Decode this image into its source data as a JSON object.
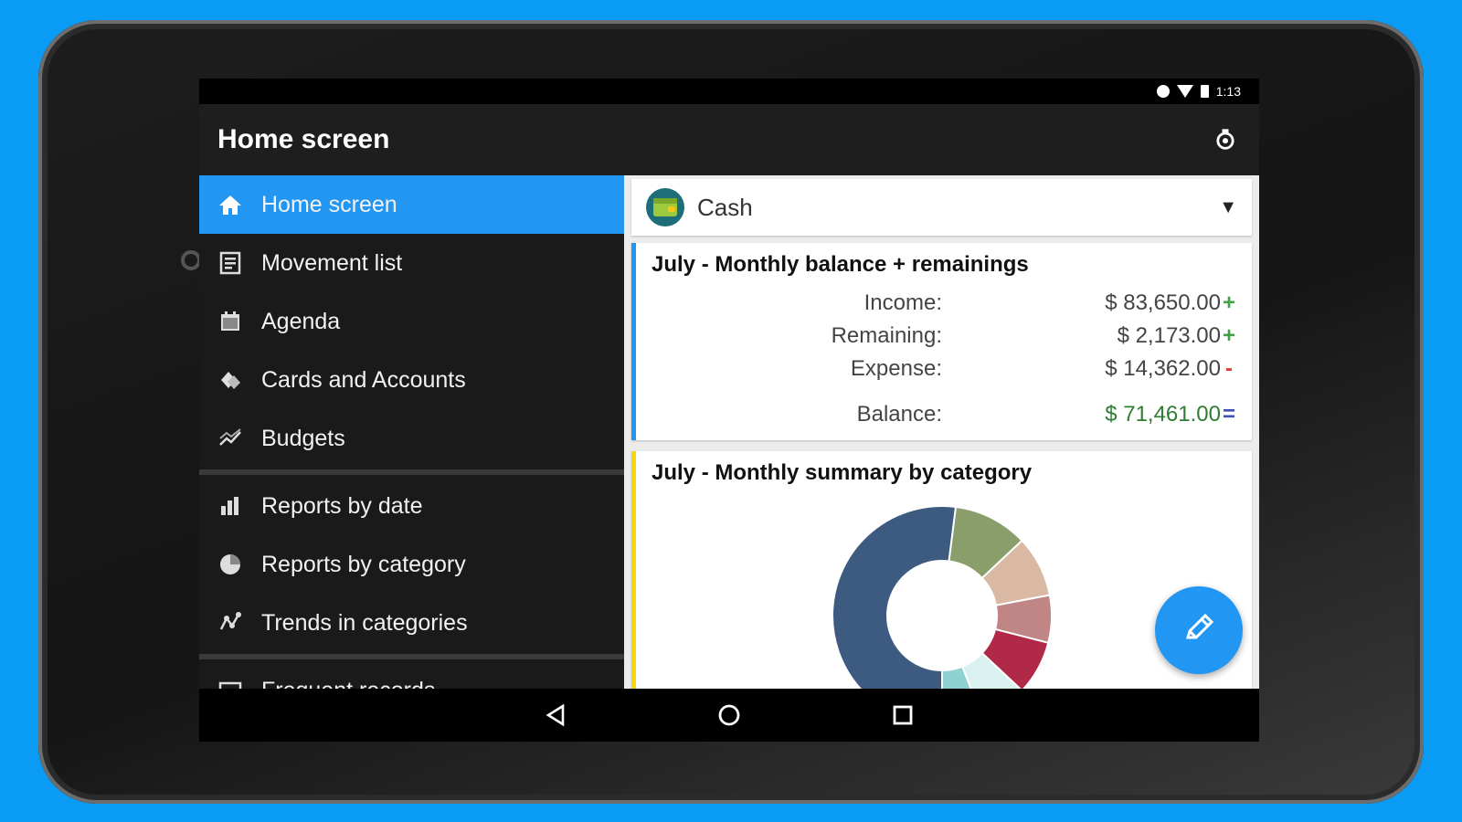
{
  "status_bar": {
    "time": "1:13"
  },
  "appbar": {
    "title": "Home screen",
    "settings_icon": "settings-gear-icon"
  },
  "drawer": {
    "items": [
      {
        "label": "Home screen",
        "icon": "home-icon",
        "active": true
      },
      {
        "label": "Movement list",
        "icon": "list-icon"
      },
      {
        "label": "Agenda",
        "icon": "calendar-icon"
      },
      {
        "label": "Cards and Accounts",
        "icon": "cards-icon"
      },
      {
        "label": "Budgets",
        "icon": "budget-icon"
      },
      {
        "label": "Reports by date",
        "icon": "bar-chart-icon"
      },
      {
        "label": "Reports by category",
        "icon": "pie-chart-icon"
      },
      {
        "label": "Trends in categories",
        "icon": "trend-icon"
      },
      {
        "label": "Frequent records",
        "icon": "frequent-icon"
      }
    ]
  },
  "account": {
    "name": "Cash",
    "icon": "wallet-icon"
  },
  "balance_card": {
    "title": "July - Monthly balance + remainings",
    "accent": "#2196f3",
    "rows": [
      {
        "label": "Income:",
        "value": "$ 83,650.00",
        "sign": "+",
        "sign_color": "#43a047",
        "value_color": "#444444"
      },
      {
        "label": "Remaining:",
        "value": "$ 2,173.00",
        "sign": "+",
        "sign_color": "#43a047",
        "value_color": "#444444"
      },
      {
        "label": "Expense:",
        "value": "$ 14,362.00",
        "sign": "-",
        "sign_color": "#e53935",
        "value_color": "#444444"
      },
      {
        "label": "Balance:",
        "value": "$ 71,461.00",
        "sign": "=",
        "sign_color": "#3f51b5",
        "value_color": "#2e7d32"
      }
    ]
  },
  "summary_card": {
    "title": "July - Monthly summary by category",
    "accent": "#f5d90a"
  },
  "chart_data": {
    "type": "pie",
    "slices": [
      {
        "value": 52,
        "color": "#3d5a80"
      },
      {
        "value": 11,
        "color": "#8a9e6b"
      },
      {
        "value": 9,
        "color": "#d9b9a4"
      },
      {
        "value": 7,
        "color": "#c08686"
      },
      {
        "value": 8,
        "color": "#b02a48"
      },
      {
        "value": 7,
        "color": "#d9f2f0"
      },
      {
        "value": 6,
        "color": "#8fd1d3"
      }
    ]
  },
  "fab": {
    "icon": "pencil-icon"
  },
  "navbar": {
    "back_icon": "back-icon",
    "home_icon": "home-circle-icon",
    "recents_icon": "recents-icon"
  }
}
